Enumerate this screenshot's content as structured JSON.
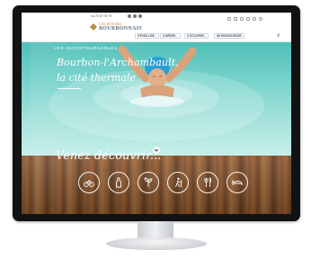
{
  "header": {
    "phone": "04 70 67 09 79",
    "social_icons": [
      "facebook-icon",
      "youtube-icon",
      "instagram-icon"
    ],
    "logo": {
      "line1": "LES ROCHES",
      "line2": "BOURBONNAIS"
    },
    "tool_icons": [
      "text-size-icon",
      "contrast-icon",
      "print-icon",
      "mail-icon",
      "translate-icon",
      "accessibility-icon"
    ],
    "nav": [
      {
        "label": "S'ÉVEILLER..."
      },
      {
        "label": "S'AÉRER..."
      },
      {
        "label": "S'OCCUPER..."
      },
      {
        "label": "SE RESSOURCER"
      }
    ],
    "search_icon": "search-icon"
  },
  "hero": {
    "kicker": "LES INCONTOURNABLES",
    "title_line1": "Bourbon-l'Archambault,",
    "title_line2": "la cité thermale"
  },
  "discover": {
    "title": "Venez découvrir...",
    "categories": [
      {
        "icon": "bike-icon"
      },
      {
        "icon": "bottle-icon"
      },
      {
        "icon": "nature-icon"
      },
      {
        "icon": "hiking-icon"
      },
      {
        "icon": "restaurant-icon"
      },
      {
        "icon": "bed-icon"
      }
    ]
  },
  "colors": {
    "accent": "#c97a2c",
    "brand": "#5a6b7a",
    "water": "#4fbfb7",
    "wood": "#7b4a26"
  }
}
